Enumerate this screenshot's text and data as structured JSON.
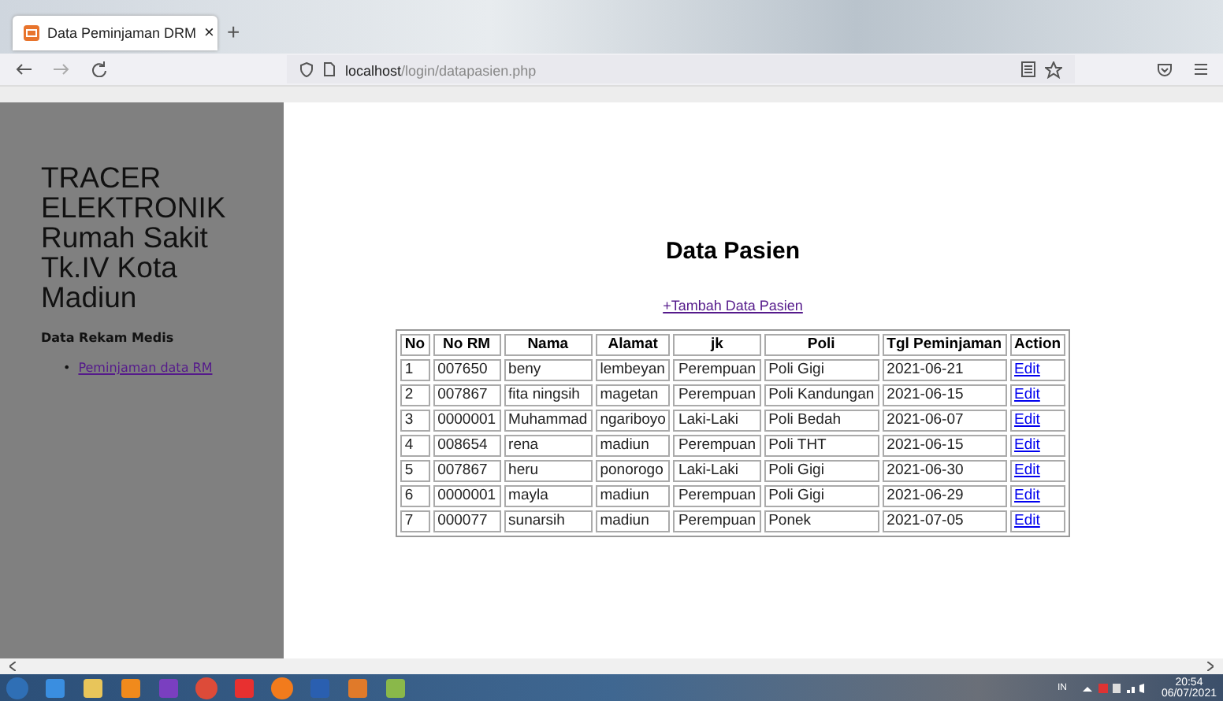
{
  "browser": {
    "tab_title": "Data Peminjaman DRM",
    "tab_close": "×",
    "new_tab": "+",
    "url_host": "localhost",
    "url_path": "/login/datapasien.php"
  },
  "sidebar": {
    "title": "TRACER ELEKTRONIK Rumah Sakit Tk.IV Kota Madiun",
    "section": "Data Rekam Medis",
    "links": [
      {
        "bullet": "•",
        "label": "Peminjaman data RM"
      }
    ]
  },
  "page": {
    "heading": "Data Pasien",
    "add_link": "+Tambah Data Pasien"
  },
  "table": {
    "columns": [
      "No",
      "No RM",
      "Nama",
      "Alamat",
      "jk",
      "Poli",
      "Tgl Peminjaman",
      "Action"
    ],
    "rows": [
      [
        "1",
        "007650",
        "beny",
        "lembeyan",
        "Perempuan",
        "Poli Gigi",
        "2021-06-21",
        "Edit"
      ],
      [
        "2",
        "007867",
        "fita ningsih",
        "magetan",
        "Perempuan",
        "Poli Kandungan",
        "2021-06-15",
        "Edit"
      ],
      [
        "3",
        "0000001",
        "Muhammad",
        "ngariboyo",
        "Laki-Laki",
        "Poli Bedah",
        "2021-06-07",
        "Edit"
      ],
      [
        "4",
        "008654",
        "rena",
        "madiun",
        "Perempuan",
        "Poli THT",
        "2021-06-15",
        "Edit"
      ],
      [
        "5",
        "007867",
        "heru",
        "ponorogo",
        "Laki-Laki",
        "Poli Gigi",
        "2021-06-30",
        "Edit"
      ],
      [
        "6",
        "0000001",
        "mayla",
        "madiun",
        "Perempuan",
        "Poli Gigi",
        "2021-06-29",
        "Edit"
      ],
      [
        "7",
        "000077",
        "sunarsih",
        "madiun",
        "Perempuan",
        "Ponek",
        "2021-07-05",
        "Edit"
      ]
    ]
  },
  "taskbar": {
    "language": "IN",
    "time": "20:54",
    "date": "06/07/2021"
  }
}
